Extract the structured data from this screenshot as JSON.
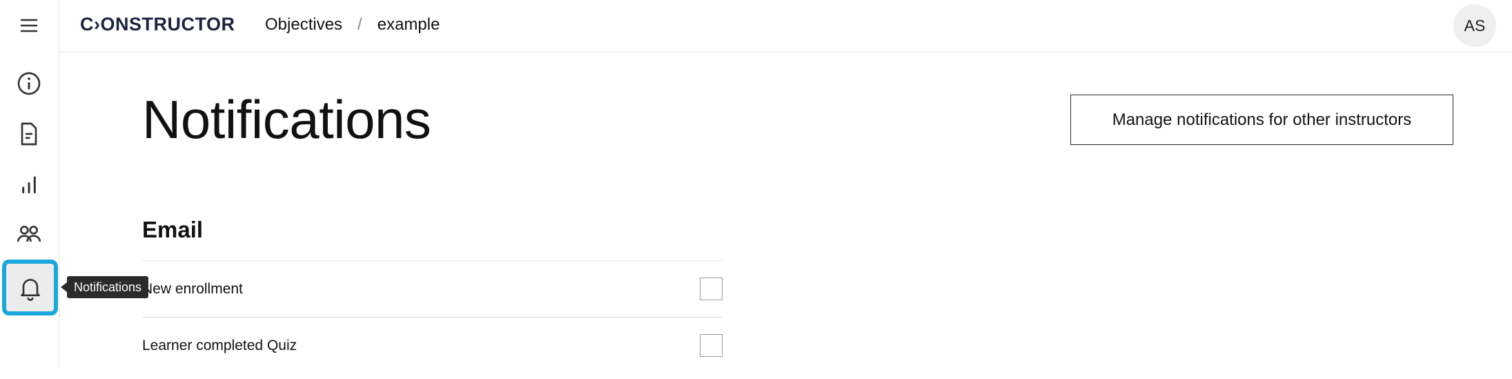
{
  "app": {
    "logo": "C›ONSTRUCTOR"
  },
  "breadcrumb": {
    "items": [
      "Objectives",
      "example"
    ],
    "separator": "/"
  },
  "user": {
    "initials": "AS"
  },
  "sidebar": {
    "items": [
      {
        "name": "menu",
        "icon": "hamburger-icon"
      },
      {
        "name": "info",
        "icon": "info-icon"
      },
      {
        "name": "document",
        "icon": "document-icon"
      },
      {
        "name": "analytics",
        "icon": "bar-chart-icon"
      },
      {
        "name": "learners",
        "icon": "people-icon"
      },
      {
        "name": "notifications",
        "icon": "bell-icon",
        "active": true
      }
    ],
    "tooltip": "Notifications"
  },
  "page": {
    "title": "Notifications",
    "manage_button": "Manage notifications for other instructors",
    "section_title": "Email",
    "settings": [
      {
        "label": "New enrollment",
        "checked": false
      },
      {
        "label": "Learner completed Quiz",
        "checked": false
      }
    ]
  },
  "colors": {
    "accent": "#1aa7db",
    "logo": "#1b2340"
  }
}
